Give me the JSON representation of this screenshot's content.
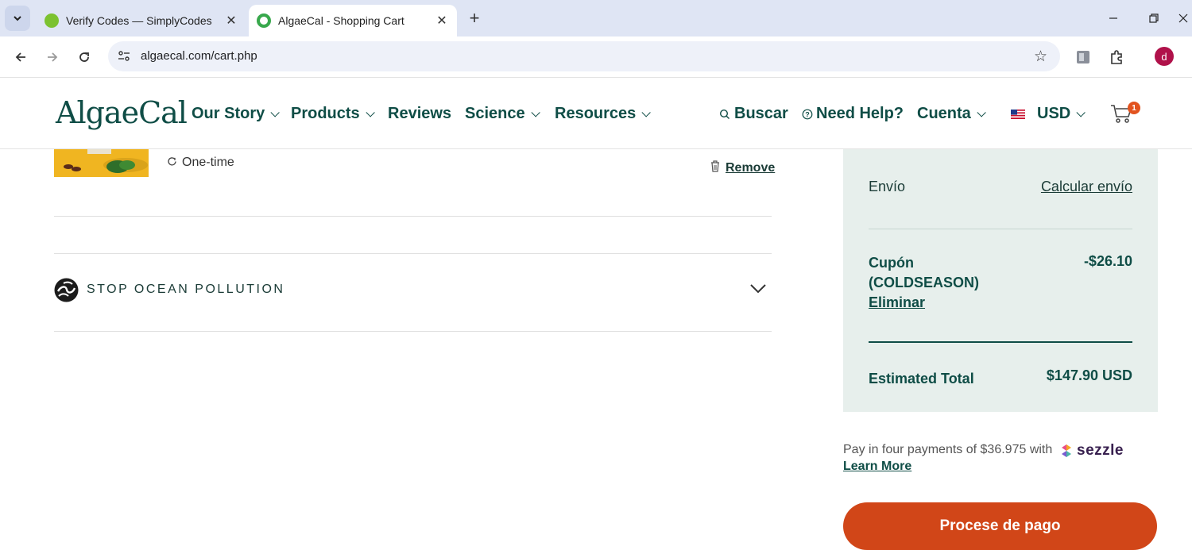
{
  "browser": {
    "tabs": [
      {
        "title": "Verify Codes — SimplyCodes",
        "active": false,
        "favicon_color": "#7cc230"
      },
      {
        "title": "AlgaeCal - Shopping Cart",
        "active": true,
        "favicon_color": "#38a84c"
      }
    ],
    "url": "algaecal.com/cart.php",
    "profile_initial": "d"
  },
  "header": {
    "logo": "AlgaeCal",
    "nav": [
      {
        "label": "Our Story",
        "has_dropdown": true
      },
      {
        "label": "Products",
        "has_dropdown": true
      },
      {
        "label": "Reviews",
        "has_dropdown": false
      },
      {
        "label": "Science",
        "has_dropdown": true
      },
      {
        "label": "Resources",
        "has_dropdown": true
      }
    ],
    "search_label": "Buscar",
    "help_label": "Need Help?",
    "account_label": "Cuenta",
    "currency_label": "USD",
    "cart_count": "1"
  },
  "cart": {
    "purchase_type": "One-time",
    "remove_label": "Remove",
    "ocean_label": "STOP OCEAN POLLUTION"
  },
  "summary": {
    "shipping_label": "Envío",
    "shipping_link": "Calcular envío",
    "coupon_label": "Cupón (COLDSEASON)",
    "coupon_remove": "Eliminar",
    "coupon_amount": "-$26.10",
    "total_label": "Estimated Total",
    "total_value": "$147.90 USD"
  },
  "payment": {
    "sezzle_text": "Pay in four payments of $36.975 with",
    "sezzle_brand": "sezzle",
    "learn_more": "Learn More",
    "checkout_button": "Procese de pago"
  },
  "colors": {
    "brand_green": "#0f4d46",
    "summary_bg": "#e7efec",
    "checkout_orange": "#d14618"
  }
}
